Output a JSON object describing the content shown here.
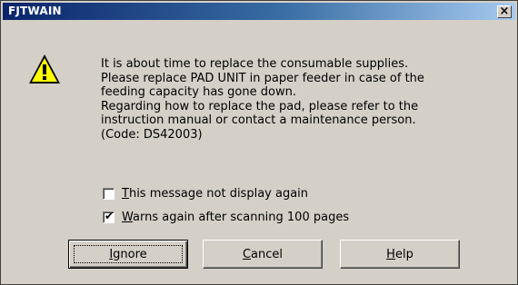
{
  "window": {
    "title": "FJTWAIN",
    "close_glyph": "×"
  },
  "icon": {
    "name": "warning-icon",
    "glyph": "!",
    "color": "#ffff00"
  },
  "message": {
    "lines": [
      "It is about time to replace the consumable supplies.",
      "Please replace PAD UNIT in paper feeder in case of the",
      "feeding capacity has gone down.",
      "Regarding how to replace the pad, please refer to the",
      "instruction manual or contact a maintenance person.",
      "(Code: DS42003)"
    ]
  },
  "options": [
    {
      "label_key": "T",
      "label_rest": "his message not display again",
      "checked": false
    },
    {
      "label_key": "W",
      "label_rest": "arns again after scanning 100 pages",
      "checked": true
    }
  ],
  "buttons": {
    "ignore": {
      "key": "I",
      "rest": "gnore"
    },
    "cancel": {
      "key": "C",
      "rest": "ancel"
    },
    "help": {
      "key": "H",
      "rest": "elp"
    }
  }
}
